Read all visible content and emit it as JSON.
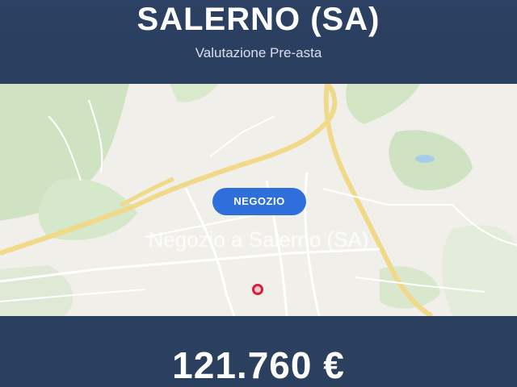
{
  "header": {
    "title": "SALERNO (SA)",
    "subtitle": "Valutazione Pre-asta"
  },
  "map": {
    "badge_label": "NEGOZIO",
    "caption": "Negozio a Salerno (SA)",
    "marker_color": "#d61f36"
  },
  "footer": {
    "price": "121.760 €"
  },
  "colors": {
    "header_bg": "#2c4163",
    "badge_bg": "#2f6fdc",
    "map_bg": "#f1efe9"
  }
}
